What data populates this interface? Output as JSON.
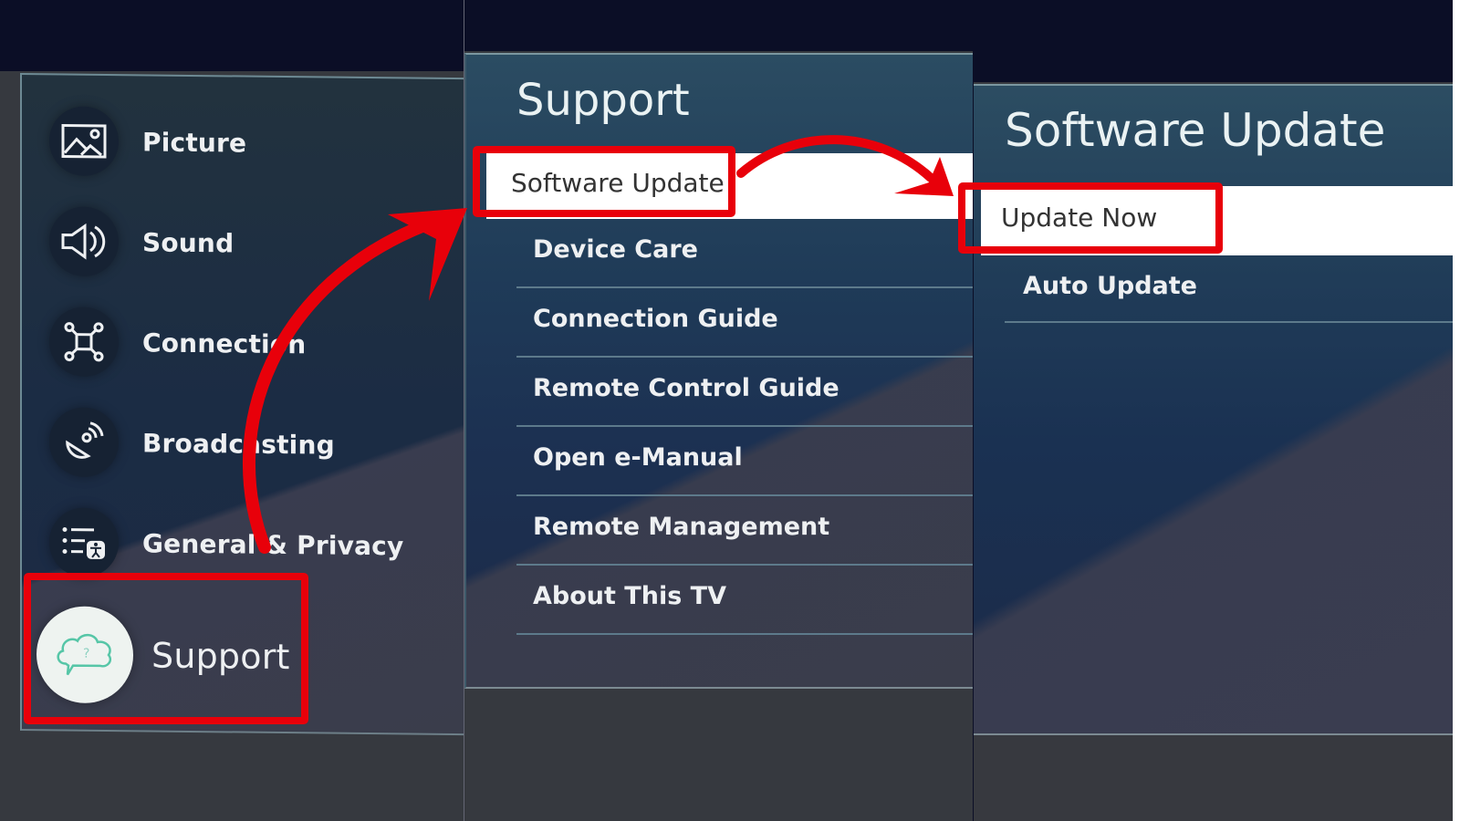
{
  "colors": {
    "annotation_red": "#e8000a",
    "selected_bg": "#ffffff",
    "menu_text": "#eef0f2",
    "background": "#0b0e26"
  },
  "settings_menu": {
    "items": [
      {
        "label": "Picture",
        "icon": "picture-icon"
      },
      {
        "label": "Sound",
        "icon": "sound-icon"
      },
      {
        "label": "Connection",
        "icon": "connection-icon"
      },
      {
        "label": "Broadcasting",
        "icon": "broadcasting-icon"
      },
      {
        "label": "General & Privacy",
        "icon": "general-privacy-icon"
      },
      {
        "label": "Support",
        "icon": "support-icon",
        "focused": true
      }
    ]
  },
  "support_menu": {
    "title": "Support",
    "selected": "Software Update",
    "items": [
      {
        "label": "Device Care"
      },
      {
        "label": "Connection Guide"
      },
      {
        "label": "Remote Control Guide"
      },
      {
        "label": "Open e-Manual"
      },
      {
        "label": "Remote Management"
      },
      {
        "label": "About This TV"
      }
    ]
  },
  "software_update_menu": {
    "title": "Software Update",
    "selected": "Update Now",
    "items": [
      {
        "label": "Auto Update"
      }
    ]
  },
  "annotations": {
    "highlights": [
      "Support",
      "Software Update",
      "Update Now"
    ],
    "arrows": [
      "support-to-software-update",
      "software-update-to-update-now"
    ]
  }
}
